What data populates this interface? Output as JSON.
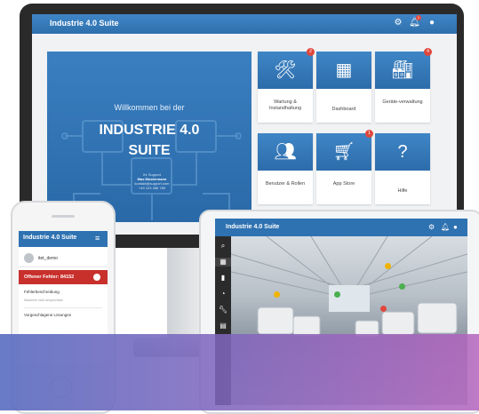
{
  "monitor": {
    "app_title": "Industrie 4.0 Suite",
    "notification_count": "1",
    "welcome": {
      "line1": "Willkommen bei der",
      "line2": "INDUSTRIE 4.0",
      "line3": "SUITE",
      "support": [
        "Ihr Support",
        "Max Mustermann",
        "kontakt@support.com",
        "+49 123 456 789"
      ]
    },
    "tiles": [
      {
        "label": "Wartung & Instandhaltung",
        "icon": "tools-icon",
        "badge": "2"
      },
      {
        "label": "Dashboard",
        "icon": "grid-icon",
        "badge": ""
      },
      {
        "label": "Geräte-verwaltung",
        "icon": "factory-icon",
        "badge": "4"
      },
      {
        "label": "Benutzer & Rollen",
        "icon": "users-icon",
        "badge": ""
      },
      {
        "label": "App Store",
        "icon": "cart-icon",
        "badge": "1"
      },
      {
        "label": "Hilfe",
        "icon": "help-icon",
        "badge": ""
      }
    ]
  },
  "phone": {
    "app_title": "Industrie 4.0 Suite",
    "username": "itet_demo",
    "error_banner": "Offener Fehler: 84152",
    "rows": [
      {
        "title": "Fehlerbeschreibung",
        "subtitle": "Maschine nicht ansprechbar"
      },
      {
        "title": "Vorgeschlagene Lösungen",
        "subtitle": ""
      }
    ]
  },
  "tablet": {
    "app_title": "Industrie 4.0 Suite",
    "sidebar_icons": [
      "search-icon",
      "grid-icon",
      "chart-icon",
      "gauge-icon",
      "wrench-icon",
      "document-icon"
    ]
  },
  "colors": {
    "primary": "#2f72b2",
    "badge": "#e0473c",
    "error": "#c8302c",
    "overlay_start": "#5468be",
    "overlay_end": "#b464be"
  }
}
